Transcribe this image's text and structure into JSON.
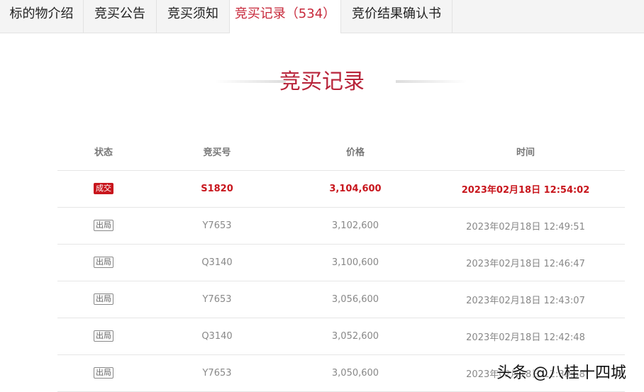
{
  "tabs": [
    {
      "label": "标的物介绍"
    },
    {
      "label": "竞买公告"
    },
    {
      "label": "竞买须知"
    },
    {
      "label": "竞买记录（534）",
      "active": true
    },
    {
      "label": "竞价结果确认书"
    }
  ],
  "section_title": "竞买记录",
  "table": {
    "headers": [
      "状态",
      "竞买号",
      "价格",
      "时间"
    ],
    "rows": [
      {
        "status": "成交",
        "bidder": "S1820",
        "price": "3,104,600",
        "time": "2023年02月18日 12:54:02"
      },
      {
        "status": "出局",
        "bidder": "Y7653",
        "price": "3,102,600",
        "time": "2023年02月18日 12:49:51"
      },
      {
        "status": "出局",
        "bidder": "Q3140",
        "price": "3,100,600",
        "time": "2023年02月18日 12:46:47"
      },
      {
        "status": "出局",
        "bidder": "Y7653",
        "price": "3,056,600",
        "time": "2023年02月18日 12:43:07"
      },
      {
        "status": "出局",
        "bidder": "Q3140",
        "price": "3,052,600",
        "time": "2023年02月18日 12:42:48"
      },
      {
        "status": "出局",
        "bidder": "Y7653",
        "price": "3,050,600",
        "time": "2023年02月18日 12:39:58"
      }
    ]
  },
  "watermark": "头条 @八桂十四城",
  "colors": {
    "accent": "#c8161d",
    "title": "#b8243a"
  }
}
